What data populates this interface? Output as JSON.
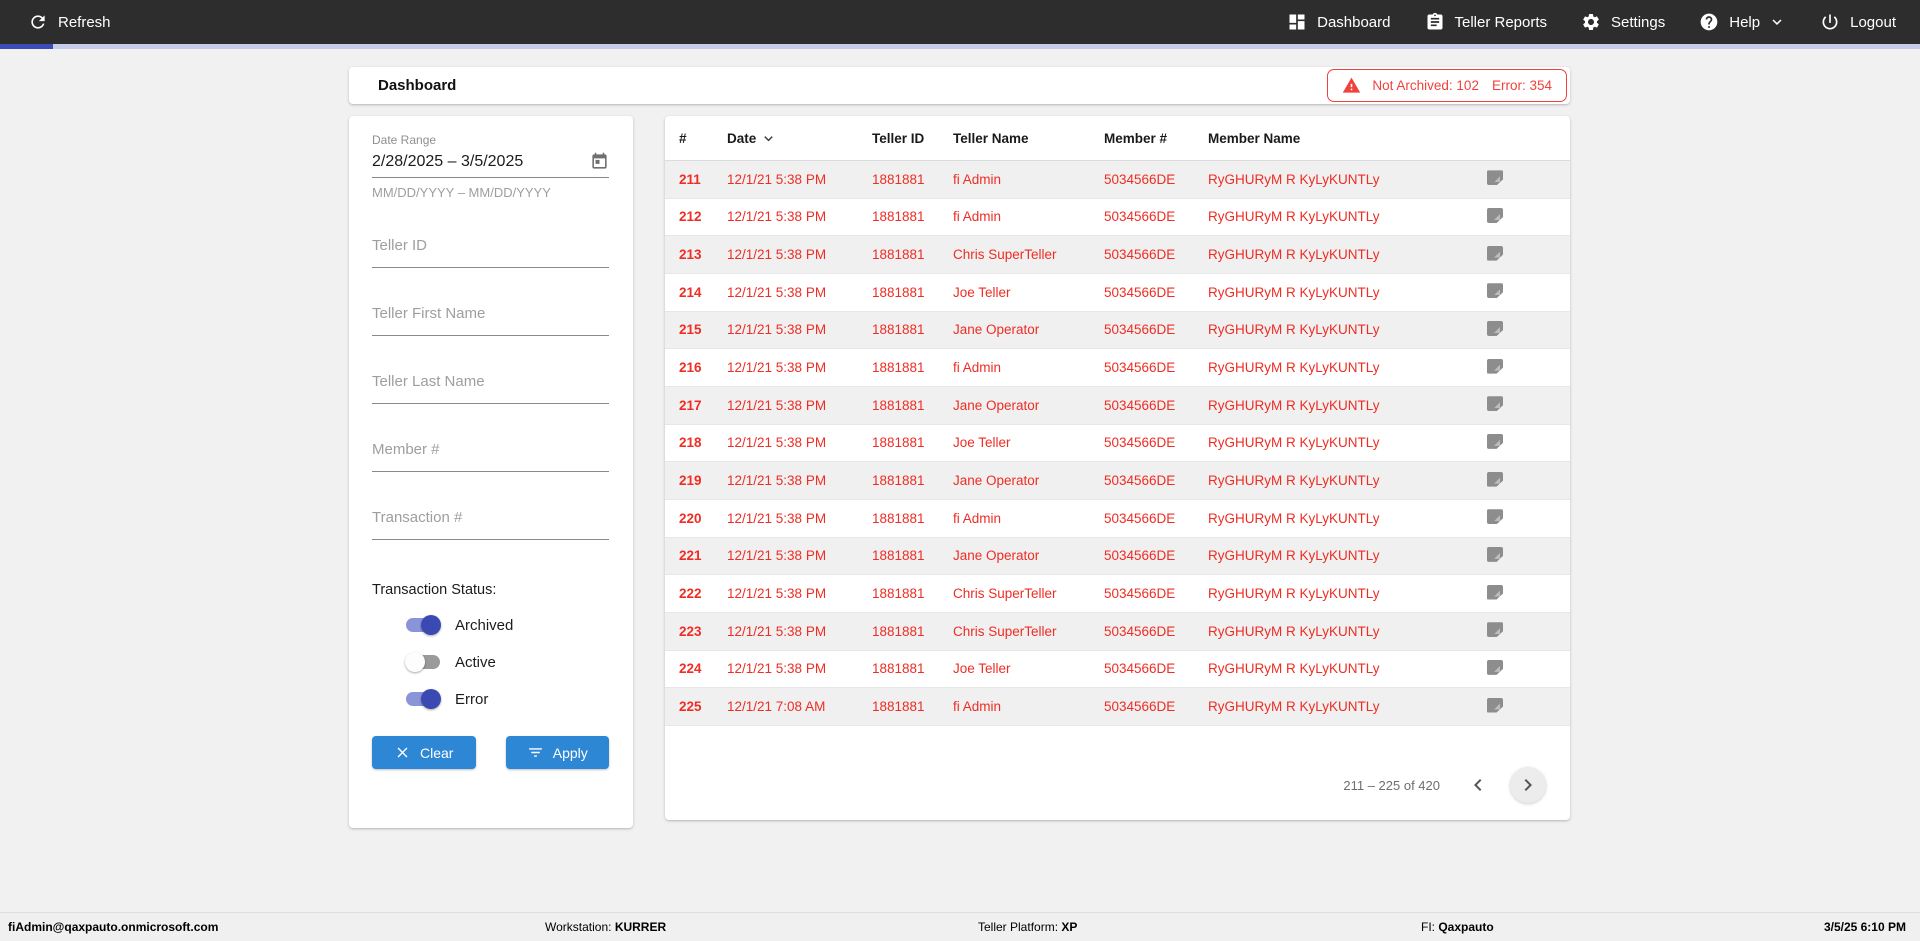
{
  "colors": {
    "nav_bg": "#2d2d2d",
    "progress_active": "#3b4cb8",
    "progress_track": "#c5cbe9",
    "accent_blue": "#2e87d5",
    "toggle_on": "#3b4ab3",
    "toggle_on_track": "#8a94d8",
    "alert_red": "#ef423d",
    "row_red": "#ee2d24"
  },
  "nav": {
    "refresh": {
      "label": "Refresh",
      "icon": "refresh-icon"
    },
    "items": [
      {
        "id": "dashboard",
        "label": "Dashboard",
        "icon": "dashboard-icon",
        "has_dropdown": false
      },
      {
        "id": "teller-reports",
        "label": "Teller Reports",
        "icon": "clipboard-icon",
        "has_dropdown": false
      },
      {
        "id": "settings",
        "label": "Settings",
        "icon": "gear-icon",
        "has_dropdown": false
      },
      {
        "id": "help",
        "label": "Help",
        "icon": "help-icon",
        "has_dropdown": true
      },
      {
        "id": "logout",
        "label": "Logout",
        "icon": "power-icon",
        "has_dropdown": false
      }
    ]
  },
  "header": {
    "title": "Dashboard",
    "alert": {
      "not_archived_label": "Not Archived:",
      "not_archived_count": "102",
      "error_label": "Error:",
      "error_count": "354"
    }
  },
  "filters": {
    "date_range": {
      "label": "Date Range",
      "value": "2/28/2025 – 3/5/2025",
      "hint": "MM/DD/YYYY – MM/DD/YYYY",
      "icon": "calendar-icon"
    },
    "fields": [
      {
        "placeholder": "Teller ID"
      },
      {
        "placeholder": "Teller First Name"
      },
      {
        "placeholder": "Teller Last Name"
      },
      {
        "placeholder": "Member #"
      },
      {
        "placeholder": "Transaction #"
      }
    ],
    "status": {
      "label": "Transaction Status:",
      "toggles": [
        {
          "label": "Archived",
          "on": true
        },
        {
          "label": "Active",
          "on": false
        },
        {
          "label": "Error",
          "on": true
        }
      ]
    },
    "buttons": {
      "clear": "Clear",
      "apply": "Apply"
    }
  },
  "table": {
    "columns": [
      "#",
      "Date",
      "Teller ID",
      "Teller Name",
      "Member #",
      "Member Name"
    ],
    "sorted_column": "Date",
    "rows": [
      {
        "num": "211",
        "date": "12/1/21 5:38 PM",
        "teller_id": "1881881",
        "teller_name": "fi Admin",
        "member_num": "5034566DE",
        "member_name": "RyGHURyM R KyLyKUNTLy"
      },
      {
        "num": "212",
        "date": "12/1/21 5:38 PM",
        "teller_id": "1881881",
        "teller_name": "fi Admin",
        "member_num": "5034566DE",
        "member_name": "RyGHURyM R KyLyKUNTLy"
      },
      {
        "num": "213",
        "date": "12/1/21 5:38 PM",
        "teller_id": "1881881",
        "teller_name": "Chris SuperTeller",
        "member_num": "5034566DE",
        "member_name": "RyGHURyM R KyLyKUNTLy"
      },
      {
        "num": "214",
        "date": "12/1/21 5:38 PM",
        "teller_id": "1881881",
        "teller_name": "Joe Teller",
        "member_num": "5034566DE",
        "member_name": "RyGHURyM R KyLyKUNTLy"
      },
      {
        "num": "215",
        "date": "12/1/21 5:38 PM",
        "teller_id": "1881881",
        "teller_name": "Jane Operator",
        "member_num": "5034566DE",
        "member_name": "RyGHURyM R KyLyKUNTLy"
      },
      {
        "num": "216",
        "date": "12/1/21 5:38 PM",
        "teller_id": "1881881",
        "teller_name": "fi Admin",
        "member_num": "5034566DE",
        "member_name": "RyGHURyM R KyLyKUNTLy"
      },
      {
        "num": "217",
        "date": "12/1/21 5:38 PM",
        "teller_id": "1881881",
        "teller_name": "Jane Operator",
        "member_num": "5034566DE",
        "member_name": "RyGHURyM R KyLyKUNTLy"
      },
      {
        "num": "218",
        "date": "12/1/21 5:38 PM",
        "teller_id": "1881881",
        "teller_name": "Joe Teller",
        "member_num": "5034566DE",
        "member_name": "RyGHURyM R KyLyKUNTLy"
      },
      {
        "num": "219",
        "date": "12/1/21 5:38 PM",
        "teller_id": "1881881",
        "teller_name": "Jane Operator",
        "member_num": "5034566DE",
        "member_name": "RyGHURyM R KyLyKUNTLy"
      },
      {
        "num": "220",
        "date": "12/1/21 5:38 PM",
        "teller_id": "1881881",
        "teller_name": "fi Admin",
        "member_num": "5034566DE",
        "member_name": "RyGHURyM R KyLyKUNTLy"
      },
      {
        "num": "221",
        "date": "12/1/21 5:38 PM",
        "teller_id": "1881881",
        "teller_name": "Jane Operator",
        "member_num": "5034566DE",
        "member_name": "RyGHURyM R KyLyKUNTLy"
      },
      {
        "num": "222",
        "date": "12/1/21 5:38 PM",
        "teller_id": "1881881",
        "teller_name": "Chris SuperTeller",
        "member_num": "5034566DE",
        "member_name": "RyGHURyM R KyLyKUNTLy"
      },
      {
        "num": "223",
        "date": "12/1/21 5:38 PM",
        "teller_id": "1881881",
        "teller_name": "Chris SuperTeller",
        "member_num": "5034566DE",
        "member_name": "RyGHURyM R KyLyKUNTLy"
      },
      {
        "num": "224",
        "date": "12/1/21 5:38 PM",
        "teller_id": "1881881",
        "teller_name": "Joe Teller",
        "member_num": "5034566DE",
        "member_name": "RyGHURyM R KyLyKUNTLy"
      },
      {
        "num": "225",
        "date": "12/1/21 7:08 AM",
        "teller_id": "1881881",
        "teller_name": "fi Admin",
        "member_num": "5034566DE",
        "member_name": "RyGHURyM R KyLyKUNTLy"
      }
    ],
    "pagination": {
      "range": "211 – 225 of 420"
    }
  },
  "footer": {
    "user": "fiAdmin@qaxpauto.onmicrosoft.com",
    "workstation_label": "Workstation:",
    "workstation": "KURRER",
    "platform_label": "Teller Platform:",
    "platform": "XP",
    "fi_label": "FI:",
    "fi": "Qaxpauto",
    "datetime": "3/5/25 6:10 PM"
  }
}
